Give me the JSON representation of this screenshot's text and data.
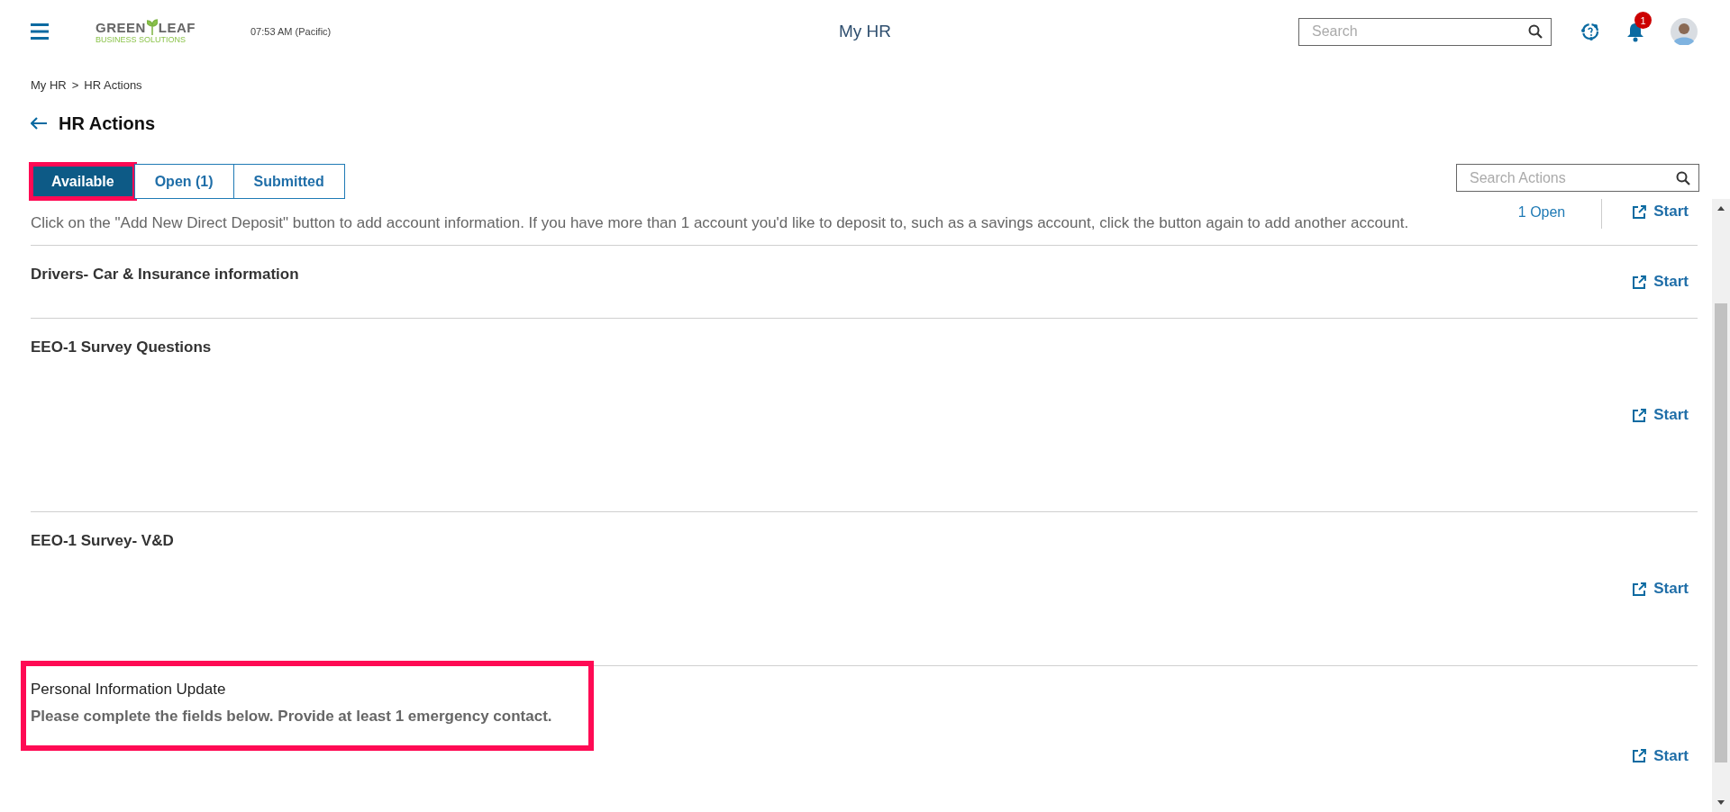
{
  "header": {
    "logo": {
      "word_1": "GREEN",
      "word_2": "LEAF",
      "tagline": "BUSINESS SOLUTIONS"
    },
    "time": "07:53 AM (Pacific)",
    "title": "My HR",
    "search": {
      "placeholder": "Search"
    },
    "notifications": {
      "badge": "1"
    }
  },
  "breadcrumb": [
    "My HR",
    "HR Actions"
  ],
  "breadcrumb_separator": ">",
  "page_title": "HR Actions",
  "tabs": [
    {
      "label": "Available",
      "selected": true,
      "highlighted": true
    },
    {
      "label": "Open (1)",
      "selected": false,
      "highlighted": false
    },
    {
      "label": "Submitted",
      "selected": false,
      "highlighted": false
    }
  ],
  "search_actions": {
    "placeholder": "Search Actions"
  },
  "actions": [
    {
      "description": "Click on the \"Add New Direct Deposit\" button to add account information. If you have more than 1 account you'd like to deposit to, such as a savings account, click the button again to add another account.",
      "open_count": "1 Open",
      "start": "Start",
      "highlighted": false
    },
    {
      "title": "Drivers- Car & Insurance information",
      "start": "Start",
      "highlighted": false
    },
    {
      "title": "EEO-1 Survey Questions",
      "start": "Start",
      "highlighted": false
    },
    {
      "title": "EEO-1 Survey- V&D",
      "start": "Start",
      "highlighted": false
    },
    {
      "title": "Personal Information Update",
      "description": "Please complete the fields below. Provide at least 1 emergency contact.",
      "start": "Start",
      "highlighted": true
    }
  ]
}
